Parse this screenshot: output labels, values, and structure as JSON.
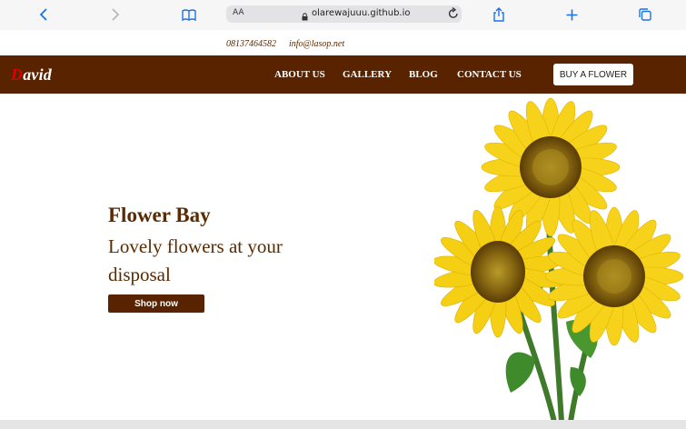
{
  "browser": {
    "url_host": "olarewajuuu.github.io",
    "reader_label": "AA",
    "icons": [
      "back-icon",
      "forward-icon",
      "bookmarks-icon",
      "lock-icon",
      "reload-icon",
      "share-icon",
      "new-tab-icon",
      "tabs-icon"
    ],
    "accent": "#1a73e8"
  },
  "contact": {
    "phone": "08137464582",
    "email": "info@lasop.net"
  },
  "nav": {
    "logo_first": "D",
    "logo_rest": "avid",
    "links": [
      "ABOUT US",
      "GALLERY",
      "BLOG",
      "CONTACT US"
    ],
    "cta": "BUY A FLOWER"
  },
  "hero": {
    "title": "Flower Bay",
    "subtitle": "Lovely flowers at your disposal",
    "button": "Shop now"
  },
  "colors": {
    "brand_brown": "#5a2300",
    "logo_red": "#e00000",
    "background": "#ffffff"
  }
}
